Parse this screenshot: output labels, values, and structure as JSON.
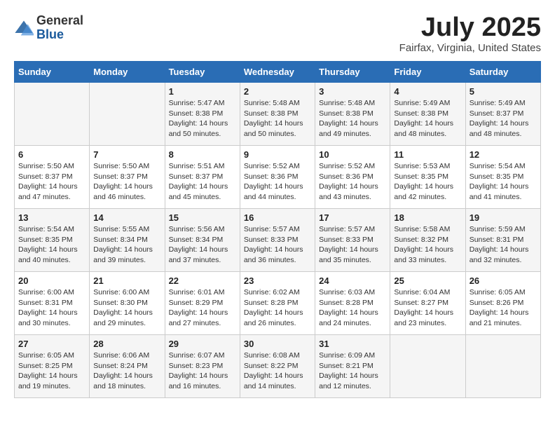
{
  "logo": {
    "general": "General",
    "blue": "Blue"
  },
  "title": "July 2025",
  "location": "Fairfax, Virginia, United States",
  "days_header": [
    "Sunday",
    "Monday",
    "Tuesday",
    "Wednesday",
    "Thursday",
    "Friday",
    "Saturday"
  ],
  "weeks": [
    [
      {
        "day": "",
        "info": ""
      },
      {
        "day": "",
        "info": ""
      },
      {
        "day": "1",
        "info": "Sunrise: 5:47 AM\nSunset: 8:38 PM\nDaylight: 14 hours and 50 minutes."
      },
      {
        "day": "2",
        "info": "Sunrise: 5:48 AM\nSunset: 8:38 PM\nDaylight: 14 hours and 50 minutes."
      },
      {
        "day": "3",
        "info": "Sunrise: 5:48 AM\nSunset: 8:38 PM\nDaylight: 14 hours and 49 minutes."
      },
      {
        "day": "4",
        "info": "Sunrise: 5:49 AM\nSunset: 8:38 PM\nDaylight: 14 hours and 48 minutes."
      },
      {
        "day": "5",
        "info": "Sunrise: 5:49 AM\nSunset: 8:37 PM\nDaylight: 14 hours and 48 minutes."
      }
    ],
    [
      {
        "day": "6",
        "info": "Sunrise: 5:50 AM\nSunset: 8:37 PM\nDaylight: 14 hours and 47 minutes."
      },
      {
        "day": "7",
        "info": "Sunrise: 5:50 AM\nSunset: 8:37 PM\nDaylight: 14 hours and 46 minutes."
      },
      {
        "day": "8",
        "info": "Sunrise: 5:51 AM\nSunset: 8:37 PM\nDaylight: 14 hours and 45 minutes."
      },
      {
        "day": "9",
        "info": "Sunrise: 5:52 AM\nSunset: 8:36 PM\nDaylight: 14 hours and 44 minutes."
      },
      {
        "day": "10",
        "info": "Sunrise: 5:52 AM\nSunset: 8:36 PM\nDaylight: 14 hours and 43 minutes."
      },
      {
        "day": "11",
        "info": "Sunrise: 5:53 AM\nSunset: 8:35 PM\nDaylight: 14 hours and 42 minutes."
      },
      {
        "day": "12",
        "info": "Sunrise: 5:54 AM\nSunset: 8:35 PM\nDaylight: 14 hours and 41 minutes."
      }
    ],
    [
      {
        "day": "13",
        "info": "Sunrise: 5:54 AM\nSunset: 8:35 PM\nDaylight: 14 hours and 40 minutes."
      },
      {
        "day": "14",
        "info": "Sunrise: 5:55 AM\nSunset: 8:34 PM\nDaylight: 14 hours and 39 minutes."
      },
      {
        "day": "15",
        "info": "Sunrise: 5:56 AM\nSunset: 8:34 PM\nDaylight: 14 hours and 37 minutes."
      },
      {
        "day": "16",
        "info": "Sunrise: 5:57 AM\nSunset: 8:33 PM\nDaylight: 14 hours and 36 minutes."
      },
      {
        "day": "17",
        "info": "Sunrise: 5:57 AM\nSunset: 8:33 PM\nDaylight: 14 hours and 35 minutes."
      },
      {
        "day": "18",
        "info": "Sunrise: 5:58 AM\nSunset: 8:32 PM\nDaylight: 14 hours and 33 minutes."
      },
      {
        "day": "19",
        "info": "Sunrise: 5:59 AM\nSunset: 8:31 PM\nDaylight: 14 hours and 32 minutes."
      }
    ],
    [
      {
        "day": "20",
        "info": "Sunrise: 6:00 AM\nSunset: 8:31 PM\nDaylight: 14 hours and 30 minutes."
      },
      {
        "day": "21",
        "info": "Sunrise: 6:00 AM\nSunset: 8:30 PM\nDaylight: 14 hours and 29 minutes."
      },
      {
        "day": "22",
        "info": "Sunrise: 6:01 AM\nSunset: 8:29 PM\nDaylight: 14 hours and 27 minutes."
      },
      {
        "day": "23",
        "info": "Sunrise: 6:02 AM\nSunset: 8:28 PM\nDaylight: 14 hours and 26 minutes."
      },
      {
        "day": "24",
        "info": "Sunrise: 6:03 AM\nSunset: 8:28 PM\nDaylight: 14 hours and 24 minutes."
      },
      {
        "day": "25",
        "info": "Sunrise: 6:04 AM\nSunset: 8:27 PM\nDaylight: 14 hours and 23 minutes."
      },
      {
        "day": "26",
        "info": "Sunrise: 6:05 AM\nSunset: 8:26 PM\nDaylight: 14 hours and 21 minutes."
      }
    ],
    [
      {
        "day": "27",
        "info": "Sunrise: 6:05 AM\nSunset: 8:25 PM\nDaylight: 14 hours and 19 minutes."
      },
      {
        "day": "28",
        "info": "Sunrise: 6:06 AM\nSunset: 8:24 PM\nDaylight: 14 hours and 18 minutes."
      },
      {
        "day": "29",
        "info": "Sunrise: 6:07 AM\nSunset: 8:23 PM\nDaylight: 14 hours and 16 minutes."
      },
      {
        "day": "30",
        "info": "Sunrise: 6:08 AM\nSunset: 8:22 PM\nDaylight: 14 hours and 14 minutes."
      },
      {
        "day": "31",
        "info": "Sunrise: 6:09 AM\nSunset: 8:21 PM\nDaylight: 14 hours and 12 minutes."
      },
      {
        "day": "",
        "info": ""
      },
      {
        "day": "",
        "info": ""
      }
    ]
  ]
}
